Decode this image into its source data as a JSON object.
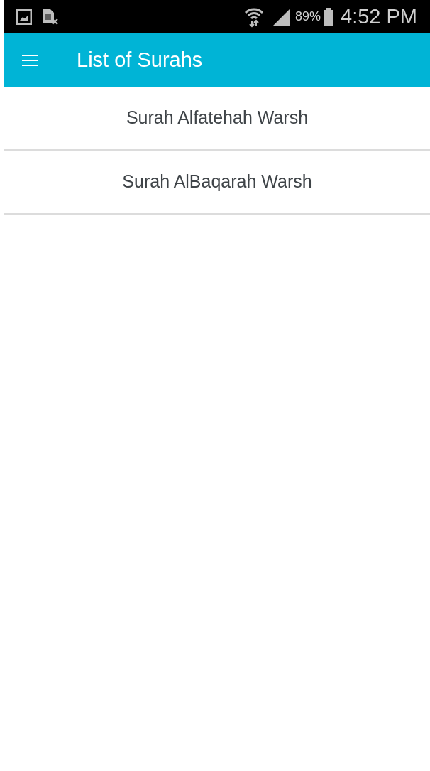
{
  "status_bar": {
    "battery": "89%",
    "time": "4:52 PM"
  },
  "app_bar": {
    "title": "List of Surahs"
  },
  "surahs": [
    {
      "name": "Surah Alfatehah Warsh"
    },
    {
      "name": "Surah AlBaqarah Warsh"
    }
  ]
}
